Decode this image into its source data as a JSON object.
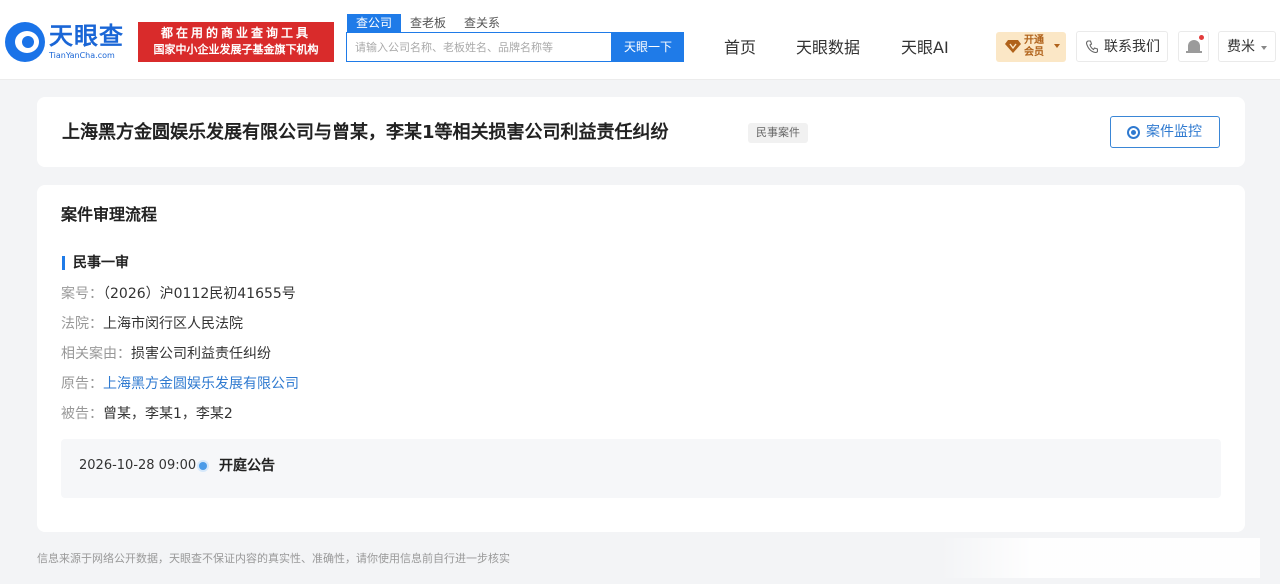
{
  "header": {
    "logo": {
      "name": "天眼查",
      "domain": "TianYanCha.com"
    },
    "slogan": {
      "line1": "都在用的商业查询工具",
      "line2": "国家中小企业发展子基金旗下机构"
    },
    "search": {
      "tabs": [
        {
          "label": "查公司",
          "active": true
        },
        {
          "label": "查老板",
          "active": false
        },
        {
          "label": "查关系",
          "active": false
        }
      ],
      "placeholder": "请输入公司名称、老板姓名、品牌名称等",
      "button_label": "天眼一下"
    },
    "nav": [
      {
        "label": "首页"
      },
      {
        "label": "天眼数据"
      },
      {
        "label": "天眼AI"
      }
    ],
    "vip": {
      "label": "开通会员",
      "icon": "diamond-icon",
      "color": "#b0621a"
    },
    "contact": {
      "label": "联系我们",
      "icon": "phone-icon"
    },
    "notifications": {
      "icon": "bell-icon",
      "has_unread": true
    },
    "user": {
      "name": "费米"
    }
  },
  "case": {
    "title": "上海黑方金圆娱乐发展有限公司与曾某，李某1等相关损害公司利益责任纠纷",
    "tag": "民事案件",
    "monitor_label": "案件监控"
  },
  "process": {
    "section_title": "案件审理流程",
    "stage": "民事一审",
    "fields": [
      {
        "label": "案号：",
        "value": "（2026）沪0112民初41655号",
        "link": false
      },
      {
        "label": "法院：",
        "value": "上海市闵行区人民法院",
        "link": false
      },
      {
        "label": "相关案由：",
        "value": "损害公司利益责任纠纷",
        "link": false
      },
      {
        "label": "原告：",
        "value": "上海黑方金圆娱乐发展有限公司",
        "link": true
      },
      {
        "label": "被告：",
        "value": "曾某，李某1，李某2",
        "link": false
      }
    ],
    "event": {
      "time": "2026-10-28 09:00",
      "title": "开庭公告"
    }
  },
  "footer": {
    "note": "信息来源于网络公开数据，天眼查不保证内容的真实性、准确性，请你使用信息前自行进一步核实"
  },
  "colors": {
    "brand": "#1f7be8",
    "slogan_bg": "#d92b2b",
    "link": "#2f7ad0"
  }
}
